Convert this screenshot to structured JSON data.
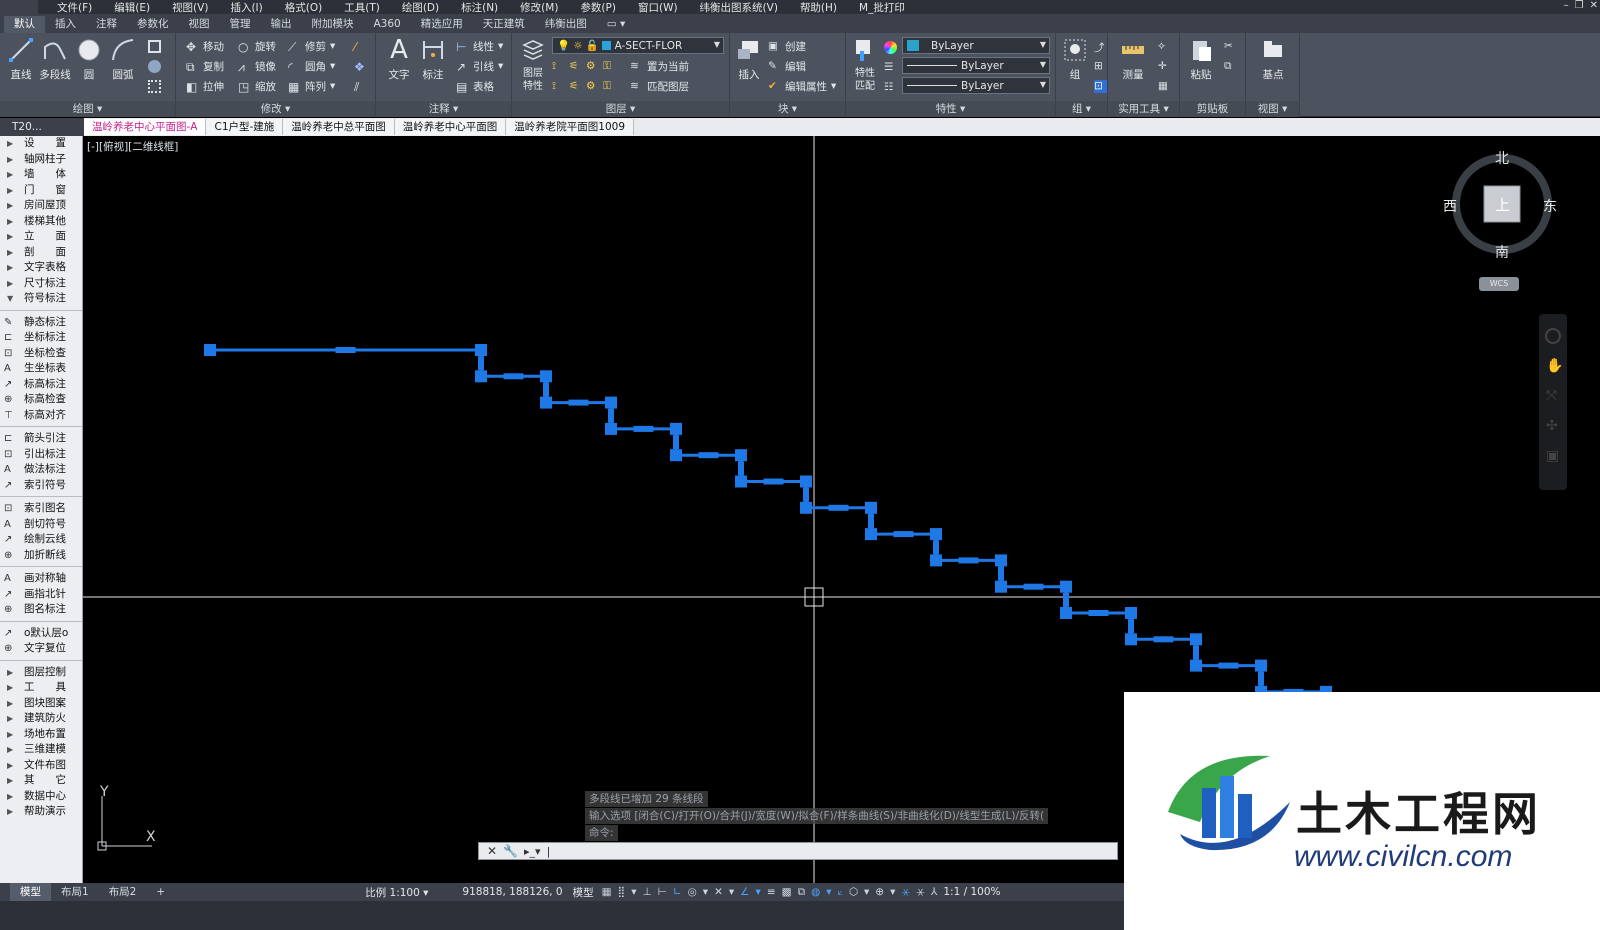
{
  "menubar": {
    "items": [
      "文件(F)",
      "编辑(E)",
      "视图(V)",
      "插入(I)",
      "格式(O)",
      "工具(T)",
      "绘图(D)",
      "标注(N)",
      "修改(M)",
      "参数(P)",
      "窗口(W)",
      "纬衡出图系统(V)",
      "帮助(H)",
      "M_批打印"
    ]
  },
  "ribbon_tabs": [
    "默认",
    "插入",
    "注释",
    "参数化",
    "视图",
    "管理",
    "输出",
    "附加模块",
    "A360",
    "精选应用",
    "天正建筑",
    "纬衡出图"
  ],
  "ribbon": {
    "draw": {
      "title": "绘图",
      "line": "直线",
      "polyline": "多段线",
      "circle": "圆",
      "arc": "圆弧"
    },
    "modify": {
      "title": "修改",
      "move": "移动",
      "rotate": "旋转",
      "trim": "修剪",
      "copy": "复制",
      "mirror": "镜像",
      "fillet": "圆角",
      "stretch": "拉伸",
      "scale": "缩放",
      "array": "阵列"
    },
    "annotation": {
      "title": "注释",
      "text": "文字",
      "dimension": "标注",
      "linear": "线性",
      "leader": "引线",
      "table": "表格"
    },
    "layers": {
      "title": "图层",
      "layer_props": "图层\n特性",
      "current_layer": "A-SECT-FLOR",
      "set_current": "置为当前",
      "match_layer": "匹配图层"
    },
    "block": {
      "title": "块",
      "insert": "插入",
      "create": "创建",
      "edit": "编辑",
      "edit_attr": "编辑属性"
    },
    "properties": {
      "title": "特性",
      "match": "特性\n匹配",
      "color": "ByLayer",
      "linetype": "ByLayer",
      "lineweight": "ByLayer"
    },
    "groups": {
      "title": "组",
      "group": "组"
    },
    "utilities": {
      "title": "实用工具",
      "measure": "测量"
    },
    "clipboard": {
      "title": "剪贴板",
      "paste": "粘贴"
    },
    "view": {
      "title": "视图",
      "base": "基点"
    }
  },
  "doc_tabs": {
    "t20": "T20...",
    "tabs": [
      "温岭养老中心平面图-A",
      "C1户型-建施",
      "温岭养老中总平面图",
      "温岭养老中心平面图",
      "温岭养老院平面图1009"
    ]
  },
  "left_panel": {
    "groups": [
      [
        "设　　置",
        "轴网柱子",
        "墙　　体",
        "门　　窗",
        "房间屋顶",
        "楼梯其他",
        "立　　面",
        "剖　　面",
        "文字表格",
        "尺寸标注",
        "符号标注"
      ],
      [
        "静态标注",
        "坐标标注",
        "坐标检查",
        "生坐标表",
        "标高标注",
        "标高检查",
        "标高对齐"
      ],
      [
        "箭头引注",
        "引出标注",
        "做法标注",
        "索引符号"
      ],
      [
        "索引图名",
        "剖切符号",
        "绘制云线",
        "加折断线"
      ],
      [
        "画对称轴",
        "画指北针",
        "图名标注"
      ],
      [
        "o默认层o",
        "文字复位"
      ],
      [
        "图层控制",
        "工　　具",
        "图块图案",
        "建筑防火",
        "场地布置",
        "三维建模",
        "文件布图",
        "其　　它",
        "数据中心",
        "帮助演示"
      ]
    ]
  },
  "canvas": {
    "view_label": "[-][俯视][二维线框]",
    "ucs_x": "X",
    "ucs_y": "Y",
    "polyline_color": "#1e78e6"
  },
  "viewcube": {
    "north": "北",
    "south": "南",
    "east": "东",
    "west": "西",
    "top": "上",
    "wcs": "WCS"
  },
  "command": {
    "history": [
      "多段线已增加 29 条线段",
      "输入选项 [闭合(C)/打开(O)/合并(J)/宽度(W)/拟合(F)/样条曲线(S)/非曲线化(D)/线型生成(L)/反转(",
      "命令:"
    ],
    "prompt": "|"
  },
  "statusbar": {
    "tabs": [
      "模型",
      "布局1",
      "布局2"
    ],
    "add": "+",
    "scale": "比例 1:100",
    "coords": "918818, 188126, 0",
    "space": "模型",
    "zoom": "1:1 / 100%"
  },
  "watermark": {
    "title": "土木工程网",
    "url": "www.civilcn.com"
  }
}
